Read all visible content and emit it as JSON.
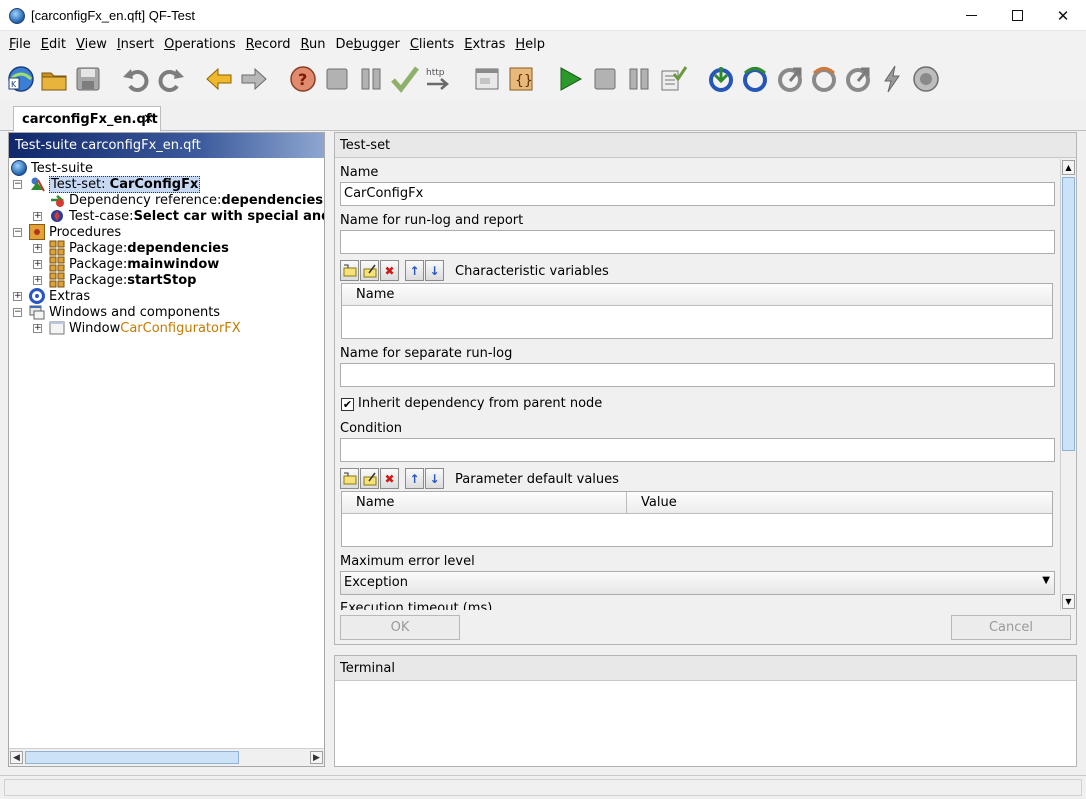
{
  "window": {
    "title": "[carconfigFx_en.qft] QF-Test"
  },
  "menu": {
    "items": [
      {
        "label": "File",
        "ul": "F",
        "rest": "ile"
      },
      {
        "label": "Edit",
        "ul": "E",
        "rest": "dit"
      },
      {
        "label": "View",
        "ul": "V",
        "rest": "iew"
      },
      {
        "label": "Insert",
        "ul": "I",
        "rest": "nsert"
      },
      {
        "label": "Operations",
        "ul": "O",
        "rest": "perations"
      },
      {
        "label": "Record",
        "ul": "R",
        "rest": "ecord"
      },
      {
        "label": "Run",
        "ul": "R",
        "rest": "un"
      },
      {
        "label": "Debugger",
        "pre": "De",
        "ul": "b",
        "rest": "ugger"
      },
      {
        "label": "Clients",
        "ul": "C",
        "rest": "lients"
      },
      {
        "label": "Extras",
        "ul": "E",
        "rest": "xtras"
      },
      {
        "label": "Help",
        "ul": "H",
        "rest": "elp"
      }
    ]
  },
  "toolbar": {
    "icons": [
      "qftest-logo-icon",
      "open-folder-icon",
      "save-icon",
      "undo-icon",
      "redo-icon",
      "back-arrow-icon",
      "forward-arrow-icon",
      "help-icon",
      "stop-icon",
      "pause-icon",
      "checkmark-icon",
      "http-icon",
      "window-icon",
      "component-icon",
      "play-icon",
      "stop-run-icon",
      "pause-run-icon",
      "check-list-icon",
      "step-in-icon",
      "step-over-icon",
      "step-out-icon",
      "skip-over-icon",
      "skip-out-icon",
      "lightning-icon",
      "record-icon"
    ],
    "http_label": "http"
  },
  "tabs": {
    "document_tab": "carconfigFx_en.qft",
    "close": "✕"
  },
  "tree": {
    "header": "Test-suite carconfigFx_en.qft",
    "nodes": {
      "root": "Test-suite",
      "testset_prefix": "Test-set: ",
      "testset_name": "CarConfigFx",
      "depref_prefix": "Dependency reference: ",
      "depref_name": "dependencies.sutStarted",
      "testcase_prefix": "Test-case: ",
      "testcase_name": "Select car with special and accessories",
      "procedures": "Procedures",
      "pkg1_prefix": "Package: ",
      "pkg1_name": "dependencies",
      "pkg2_prefix": "Package: ",
      "pkg2_name": "mainwindow",
      "pkg3_prefix": "Package: ",
      "pkg3_name": "startStop",
      "extras": "Extras",
      "windows": "Windows and components",
      "window_prefix": "Window ",
      "window_name": "CarConfiguratorFX"
    }
  },
  "detail": {
    "header": "Test-set",
    "name_label": "Name",
    "name_value": "CarConfigFx",
    "runlog_label": "Name for run-log and report",
    "runlog_value": "",
    "charvars_title": "Characteristic variables",
    "charvars_columns": [
      "Name"
    ],
    "separate_label": "Name for separate run-log",
    "separate_value": "",
    "inherit_label": "Inherit dependency from parent node",
    "inherit_checked": true,
    "condition_label": "Condition",
    "condition_value": "",
    "params_title": "Parameter default values",
    "params_columns": [
      "Name",
      "Value"
    ],
    "max_error_label": "Maximum error level",
    "max_error_value": "Exception",
    "timeout_label": "Execution timeout (ms)",
    "ok_label": "OK",
    "cancel_label": "Cancel"
  },
  "terminal": {
    "header": "Terminal"
  }
}
